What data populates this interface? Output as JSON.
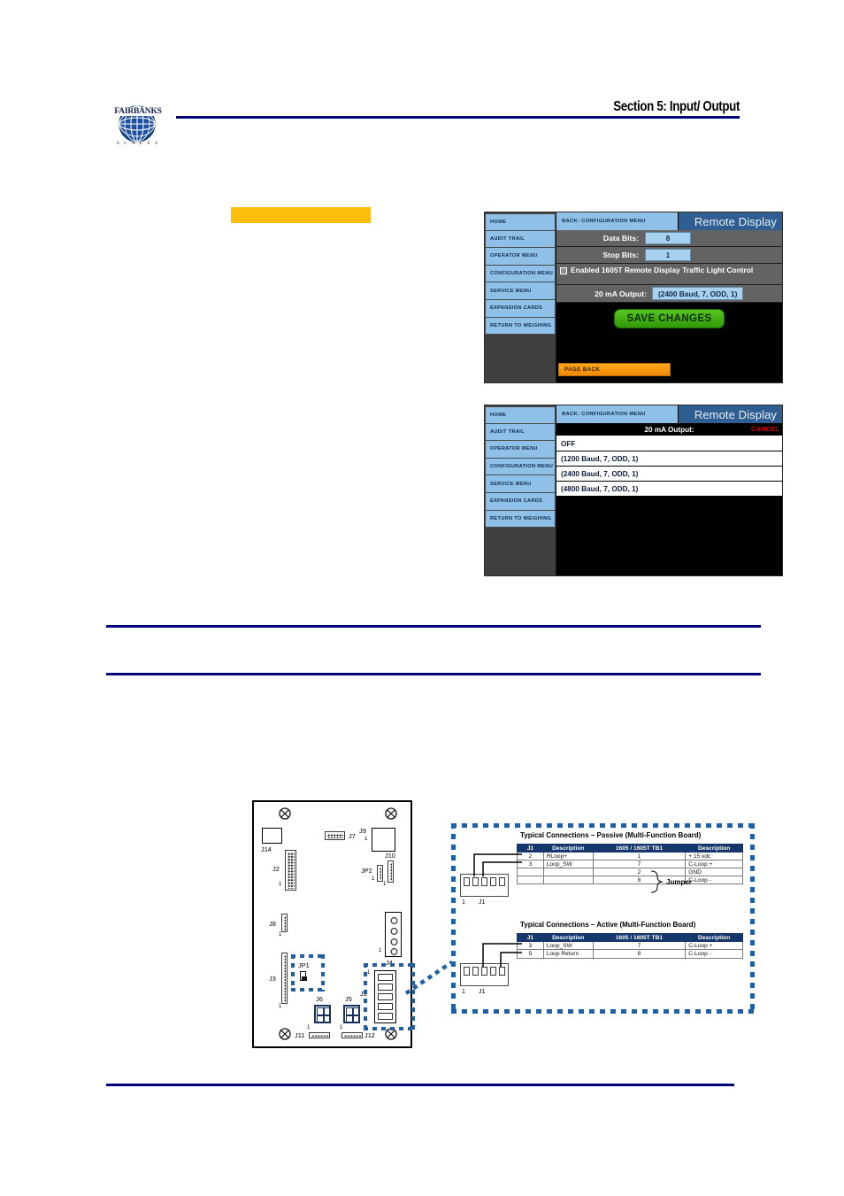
{
  "header": {
    "brand_name": "FAIRBANKS",
    "brand_sub": "S C A L E S",
    "logo_icon": "globe-icon",
    "section_title": "Section 5: Input/ Output",
    "rule_color": "#00007a"
  },
  "highlight": {
    "color": "#fdbe0b",
    "text": ""
  },
  "terminal_common": {
    "sidebar_items": [
      "HOME",
      "AUDIT TRAIL",
      "OPERATOR MENU",
      "CONFIGURATION MENU",
      "SERVICE MENU",
      "EXPANSION CARDS",
      "RETURN TO WEIGHING"
    ],
    "back_label": "BACK: CONFIGURATION MENU",
    "screen_title": "Remote Display",
    "colors": {
      "sidebar_item": "#8fc0e8",
      "title_bar": "#2f5f92",
      "field_bg": "#636363",
      "value_bg": "#a8d0ef",
      "save_button": "#3faa0c",
      "page_back": "#f79520",
      "cancel": "#e00000"
    }
  },
  "terminal_one": {
    "fields": [
      {
        "label": "Data Bits:",
        "value": "8"
      },
      {
        "label": "Stop Bits:",
        "value": "1"
      }
    ],
    "checkbox": {
      "label": "Enabled 1605T Remote Display Traffic Light Control",
      "checked": false
    },
    "output_row": {
      "label": "20 mA Output:",
      "value": "(2400 Baud, 7, ODD, 1)"
    },
    "save_label": "SAVE CHANGES",
    "page_back_label": "PAGE BACK"
  },
  "terminal_two": {
    "list_header": "20 mA Output:",
    "cancel_label": "CANCEL",
    "options": [
      "OFF",
      "(1200 Baud, 7, ODD, 1)",
      "(2400 Baud, 7, ODD, 1)",
      "(4800 Baud, 7, ODD, 1)"
    ]
  },
  "board": {
    "labels": [
      "J14",
      "J7",
      "J9",
      "J10",
      "J2",
      "JP2",
      "J8",
      "J4",
      "JP1",
      "J3",
      "J6",
      "J5",
      "J1",
      "J11",
      "J12"
    ],
    "pin_one_marks": [
      "1",
      "1",
      "1",
      "1",
      "1",
      "1",
      "1",
      "1",
      "1",
      "1"
    ],
    "highlight_color": "#1f5fa8"
  },
  "callout": {
    "passive": {
      "title": "Typical Connections – Passive (Multi-Function Board)",
      "columns": [
        "J1",
        "Description",
        "1605 / 1605T TB1",
        "Description"
      ],
      "rows": [
        [
          "2",
          "RLoop+",
          "1",
          "+ 15 vdc"
        ],
        [
          "3",
          "Loop_SW",
          "7",
          "C-Loop +"
        ],
        [
          "",
          "",
          "2",
          "GND"
        ],
        [
          "",
          "",
          "8",
          "C-Loop -"
        ]
      ],
      "jumper_label": "Jumper",
      "connector_label": "J1",
      "connector_pin1": "1"
    },
    "active": {
      "title": "Typical Connections – Active (Multi-Function Board)",
      "columns": [
        "J1",
        "Description",
        "1605 / 1605T TB1",
        "Description"
      ],
      "rows": [
        [
          "3",
          "Loop_SW",
          "7",
          "C-Loop +"
        ],
        [
          "5",
          "Loop Return",
          "8",
          "C-Loop -"
        ]
      ],
      "connector_label": "J1",
      "connector_pin1": "1"
    }
  }
}
